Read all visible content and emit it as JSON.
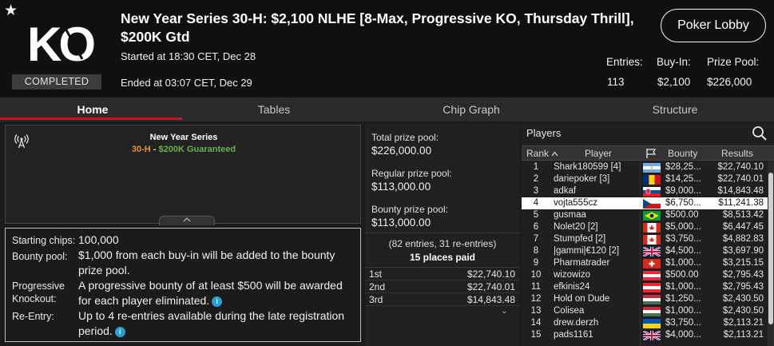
{
  "header": {
    "star_glyph": "★",
    "logo_text": "KO",
    "status": "COMPLETED",
    "title": "New Year Series 30-H: $2,100 NLHE [8-Max, Progressive KO, Thursday Thrill], $200K Gtd",
    "started": "Started at 18:30 CET, Dec 28",
    "ended": "Ended at 03:07 CET, Dec 29",
    "lobby_button": "Poker Lobby",
    "stats": [
      {
        "label": "Entries:",
        "value": "113"
      },
      {
        "label": "Buy-In:",
        "value": "$2,100"
      },
      {
        "label": "Prize Pool:",
        "value": "$226,000"
      }
    ]
  },
  "tabs": [
    "Home",
    "Tables",
    "Chip Graph",
    "Structure"
  ],
  "active_tab": "Home",
  "series": {
    "name": "New Year Series",
    "code": "30-H",
    "dash": " - ",
    "guarantee": "$200K Guaranteed",
    "icon": "broadcast-icon"
  },
  "details": {
    "starting_chips_label": "Starting chips:",
    "starting_chips_value": "100,000",
    "bounty_pool_label": "Bounty pool:",
    "bounty_pool_value": "$1,000 from each buy-in will be added to the bounty prize pool.",
    "pko_label_1": "Progressive",
    "pko_label_2": "Knockout:",
    "pko_value": "A progressive bounty of at least $500 will be awarded for each player eliminated.",
    "reentry_label": "Re-Entry:",
    "reentry_value": "Up to 4 re-entries available during the late registration period.",
    "info_glyph": "i"
  },
  "prizes": {
    "total_label": "Total prize pool:",
    "total_value": "$226,000.00",
    "regular_label": "Regular prize pool:",
    "regular_value": "$113,000.00",
    "bounty_label": "Bounty prize pool:",
    "bounty_value": "$113,000.00",
    "entries_text": "(82 entries, 31 re-entries)",
    "places_text": "15 places paid",
    "payouts": [
      {
        "place": "1st",
        "amount": "$22,740.10"
      },
      {
        "place": "2nd",
        "amount": "$22,740.01"
      },
      {
        "place": "3rd",
        "amount": "$14,843.48"
      }
    ],
    "more_glyph": "⌄"
  },
  "players": {
    "title": "Players",
    "columns": {
      "rank": "Rank",
      "player": "Player",
      "bounty": "Bounty",
      "results": "Results"
    },
    "selected_rank": 4,
    "rows": [
      {
        "rank": "1",
        "name": "Shark180599 [4]",
        "flag": "argentina",
        "bounty": "$28,25...",
        "result": "$22,740.10"
      },
      {
        "rank": "2",
        "name": "dariepoker [3]",
        "flag": "romania",
        "bounty": "$14,25...",
        "result": "$22,740.01"
      },
      {
        "rank": "3",
        "name": "adkaf",
        "flag": "slovakia",
        "bounty": "$9,000...",
        "result": "$14,843.48"
      },
      {
        "rank": "4",
        "name": "vojta555cz",
        "flag": "czechia",
        "bounty": "$6,750...",
        "result": "$11,241.38"
      },
      {
        "rank": "5",
        "name": "gusmaa",
        "flag": "brazil",
        "bounty": "$500.00",
        "result": "$8,513.42"
      },
      {
        "rank": "6",
        "name": "Nolet20 [2]",
        "flag": "canada",
        "bounty": "$5,000...",
        "result": "$6,447.45"
      },
      {
        "rank": "7",
        "name": "Stumpfed [2]",
        "flag": "canada",
        "bounty": "$3,750...",
        "result": "$4,882.83"
      },
      {
        "rank": "8",
        "name": "|gammi|€120 [2]",
        "flag": "united-kingdom",
        "bounty": "$4,500...",
        "result": "$3,697.90"
      },
      {
        "rank": "9",
        "name": "Pharmatrader",
        "flag": "switzerland",
        "bounty": "$1,000...",
        "result": "$3,215.15"
      },
      {
        "rank": "10",
        "name": "wizowizo",
        "flag": "austria",
        "bounty": "$500.00",
        "result": "$2,795.43"
      },
      {
        "rank": "11",
        "name": "efkinis24",
        "flag": "austria",
        "bounty": "$1,000...",
        "result": "$2,795.43"
      },
      {
        "rank": "12",
        "name": "Hold on Dude",
        "flag": "hungary",
        "bounty": "$1,250...",
        "result": "$2,430.50"
      },
      {
        "rank": "13",
        "name": "Colisea",
        "flag": "hungary",
        "bounty": "$1,000...",
        "result": "$2,430.50"
      },
      {
        "rank": "14",
        "name": "drew.derzh",
        "flag": "ukraine",
        "bounty": "$3,750...",
        "result": "$2,113.21"
      },
      {
        "rank": "15",
        "name": "pads1161",
        "flag": "united-kingdom",
        "bounty": "$4,000...",
        "result": "$2,113.21"
      }
    ]
  },
  "colors": {
    "accent_red": "#c2172a",
    "series_code": "#e8903a",
    "guarantee_green": "#6ab04c",
    "info_blue": "#2a9fd6"
  }
}
